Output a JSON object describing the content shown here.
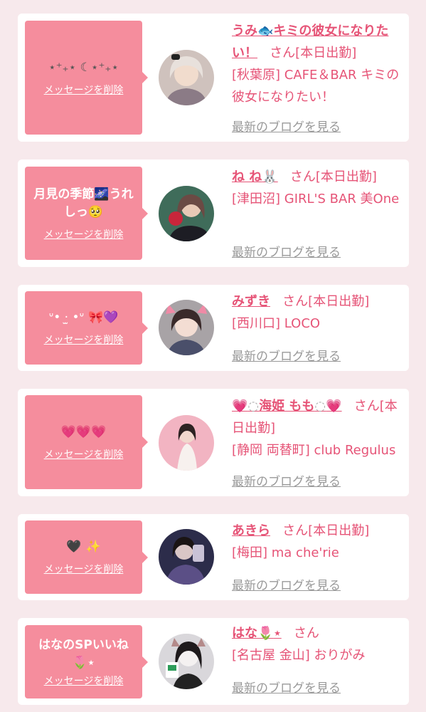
{
  "delete_label": "メッセージを削除",
  "blog_label": "最新のブログを見る",
  "san_label": "さん",
  "shift_label": "[本日出勤]",
  "colors": {
    "background": "#f7e9ec",
    "card": "#ffffff",
    "bubble": "#f58d9d",
    "accent_text": "#e65477",
    "muted_link": "#999999"
  },
  "items": [
    {
      "message": "⋆⁺₊⋆ ☾⋆⁺₊⋆",
      "name_a": "うみ",
      "name_emoji": "🐟",
      "name_b": "キミの彼女になりたい！",
      "shop": "[秋葉原] CAFE＆BAR キミの彼女になりたい！"
    },
    {
      "message_a": "月見の季節",
      "message_emoji": "🌌",
      "message_b": "うれしっ",
      "message_emoji2": "🥺",
      "name_a": "ね ね",
      "name_emoji": "🐰",
      "shop": "[津田沼] GIRL'S BAR 美One"
    },
    {
      "message_sym": "ᐡ• ·̫ •ᐡ",
      "message_emoji": "🎀💜",
      "name_a": "みずき",
      "shop": "[西川口] LOCO"
    },
    {
      "message_emoji": "💗💗💗",
      "name_emoji_l": "💗",
      "name_bubble": "◌",
      "name_a": "海姫 もも",
      "name_emoji_r": "💗",
      "shop": "[静岡 両替町] club Regulus"
    },
    {
      "message_black": "🖤",
      "message_emoji": "✨",
      "name_a": "あきら",
      "shop": "[梅田] ma che'rie"
    },
    {
      "message_a": "はなのSPいいね",
      "message_emoji": "🌷",
      "message_tail": "⋆",
      "name_a": "はな",
      "name_emoji": "🌷",
      "name_tail": "⋆",
      "shop": "[名古屋 金山] おりがみ"
    }
  ]
}
